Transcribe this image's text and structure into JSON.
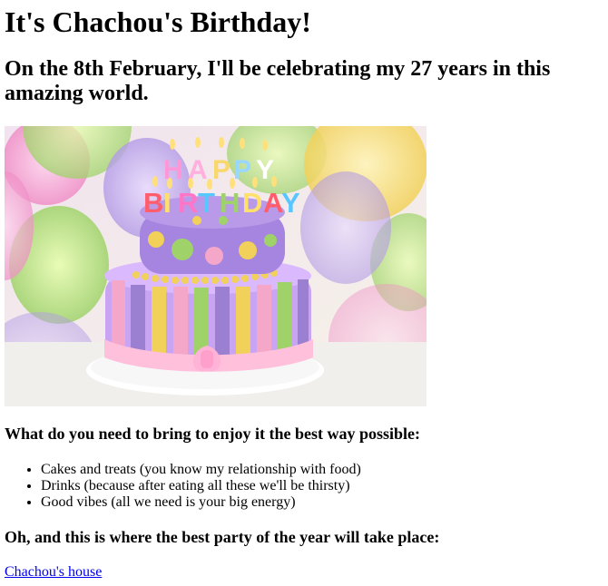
{
  "page": {
    "title": "It's Chachou's Birthday!",
    "subtitle": "On the 8th February, I'll be celebrating my 27 years in this amazing world."
  },
  "image": {
    "cake_text_top": "HAPPY",
    "cake_text_bottom": "BIRTHDAY",
    "colors": {
      "cake_purple": "#9b7fd0",
      "cake_pink": "#f4a7c8",
      "cake_yellow": "#f2d15a",
      "cake_green": "#9fd36a",
      "background_bokeh_pink": "#f7b6d8",
      "background_bokeh_green": "#b7e07a"
    }
  },
  "bring_section": {
    "heading": "What do you need to bring to enjoy it the best way possible:",
    "items": [
      "Cakes and treats (you know my relationship with food)",
      "Drinks (because after eating all these we'll be thirsty)",
      "Good vibes (all we need is your big energy)"
    ]
  },
  "location_section": {
    "heading": "Oh, and this is where the best party of the year will take place:",
    "link_text": "Chachou's house"
  }
}
